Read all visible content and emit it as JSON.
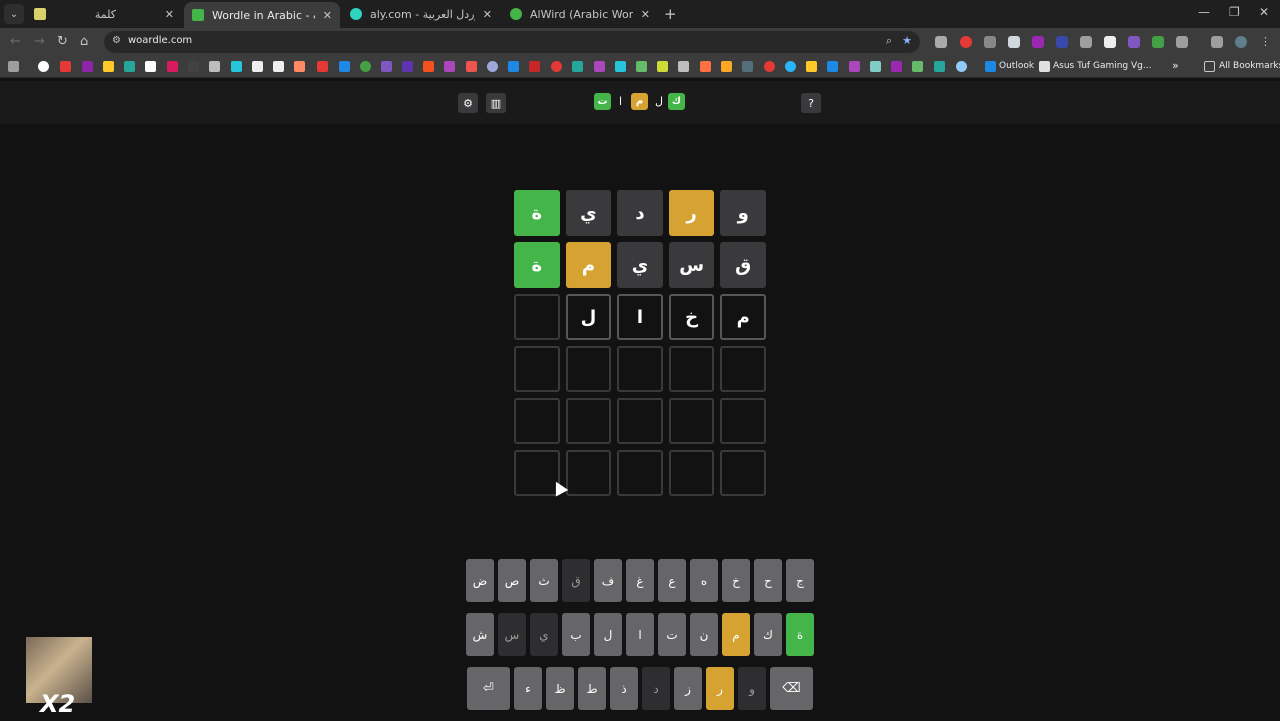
{
  "browser": {
    "tabs": [
      {
        "title": "كلمة",
        "favicon_color": "#d9d26a",
        "active": false
      },
      {
        "title": "Wordle in Arabic - كلمات",
        "favicon_color": "#44b548",
        "active": true
      },
      {
        "title": "aly.com - كلمالي - وردل العربية",
        "favicon_color": "#2dd4bf",
        "active": false
      },
      {
        "title": "AlWird (Arabic Wordle) - الورد",
        "favicon_color": "#44b548",
        "active": false
      }
    ],
    "url": "woardle.com",
    "bookmarks": {
      "outlook_label": "Outlook",
      "asus_label": "Asus Tuf Gaming Vg...",
      "all_bookmarks_label": "All Bookmarks"
    }
  },
  "game": {
    "logo": [
      {
        "letter": "ك",
        "state": "correct"
      },
      {
        "letter": "ل",
        "state": "plain"
      },
      {
        "letter": "م",
        "state": "present"
      },
      {
        "letter": "ا",
        "state": "plain"
      },
      {
        "letter": "ت",
        "state": "correct"
      }
    ],
    "help_label": "?",
    "board": [
      [
        {
          "l": "و",
          "s": "absent"
        },
        {
          "l": "ر",
          "s": "present"
        },
        {
          "l": "د",
          "s": "absent"
        },
        {
          "l": "ي",
          "s": "absent"
        },
        {
          "l": "ة",
          "s": "correct"
        }
      ],
      [
        {
          "l": "ق",
          "s": "absent"
        },
        {
          "l": "س",
          "s": "absent"
        },
        {
          "l": "ي",
          "s": "absent"
        },
        {
          "l": "م",
          "s": "present"
        },
        {
          "l": "ة",
          "s": "correct"
        }
      ],
      [
        {
          "l": "م",
          "s": "typed"
        },
        {
          "l": "خ",
          "s": "typed"
        },
        {
          "l": "ا",
          "s": "typed"
        },
        {
          "l": "ل",
          "s": "typed"
        },
        {
          "l": "",
          "s": "empty"
        }
      ],
      [
        {
          "l": "",
          "s": "empty"
        },
        {
          "l": "",
          "s": "empty"
        },
        {
          "l": "",
          "s": "empty"
        },
        {
          "l": "",
          "s": "empty"
        },
        {
          "l": "",
          "s": "empty"
        }
      ],
      [
        {
          "l": "",
          "s": "empty"
        },
        {
          "l": "",
          "s": "empty"
        },
        {
          "l": "",
          "s": "empty"
        },
        {
          "l": "",
          "s": "empty"
        },
        {
          "l": "",
          "s": "empty"
        }
      ],
      [
        {
          "l": "",
          "s": "empty"
        },
        {
          "l": "",
          "s": "empty"
        },
        {
          "l": "",
          "s": "empty"
        },
        {
          "l": "",
          "s": "empty"
        },
        {
          "l": "",
          "s": "empty"
        }
      ]
    ],
    "keyboard": [
      [
        {
          "k": "ج"
        },
        {
          "k": "ح"
        },
        {
          "k": "خ"
        },
        {
          "k": "ه"
        },
        {
          "k": "ع"
        },
        {
          "k": "غ"
        },
        {
          "k": "ف"
        },
        {
          "k": "ق",
          "s": "absent"
        },
        {
          "k": "ث"
        },
        {
          "k": "ص"
        },
        {
          "k": "ض"
        }
      ],
      [
        {
          "k": "ة",
          "s": "correct"
        },
        {
          "k": "ك"
        },
        {
          "k": "م",
          "s": "present"
        },
        {
          "k": "ن"
        },
        {
          "k": "ت"
        },
        {
          "k": "ا"
        },
        {
          "k": "ل"
        },
        {
          "k": "ب"
        },
        {
          "k": "ي",
          "s": "absent"
        },
        {
          "k": "س",
          "s": "absent"
        },
        {
          "k": "ش"
        }
      ],
      [
        {
          "k": "⌫",
          "wide": true
        },
        {
          "k": "و",
          "s": "absent"
        },
        {
          "k": "ر",
          "s": "present"
        },
        {
          "k": "ز"
        },
        {
          "k": "د",
          "s": "absent"
        },
        {
          "k": "ذ"
        },
        {
          "k": "ط"
        },
        {
          "k": "ظ"
        },
        {
          "k": "ء"
        },
        {
          "k": "⏎",
          "wide": true
        }
      ]
    ]
  },
  "overlay": {
    "speed_label": "X2"
  },
  "colors": {
    "correct": "#44b548",
    "present": "#d6a231",
    "absent": "#3a3a3c"
  }
}
